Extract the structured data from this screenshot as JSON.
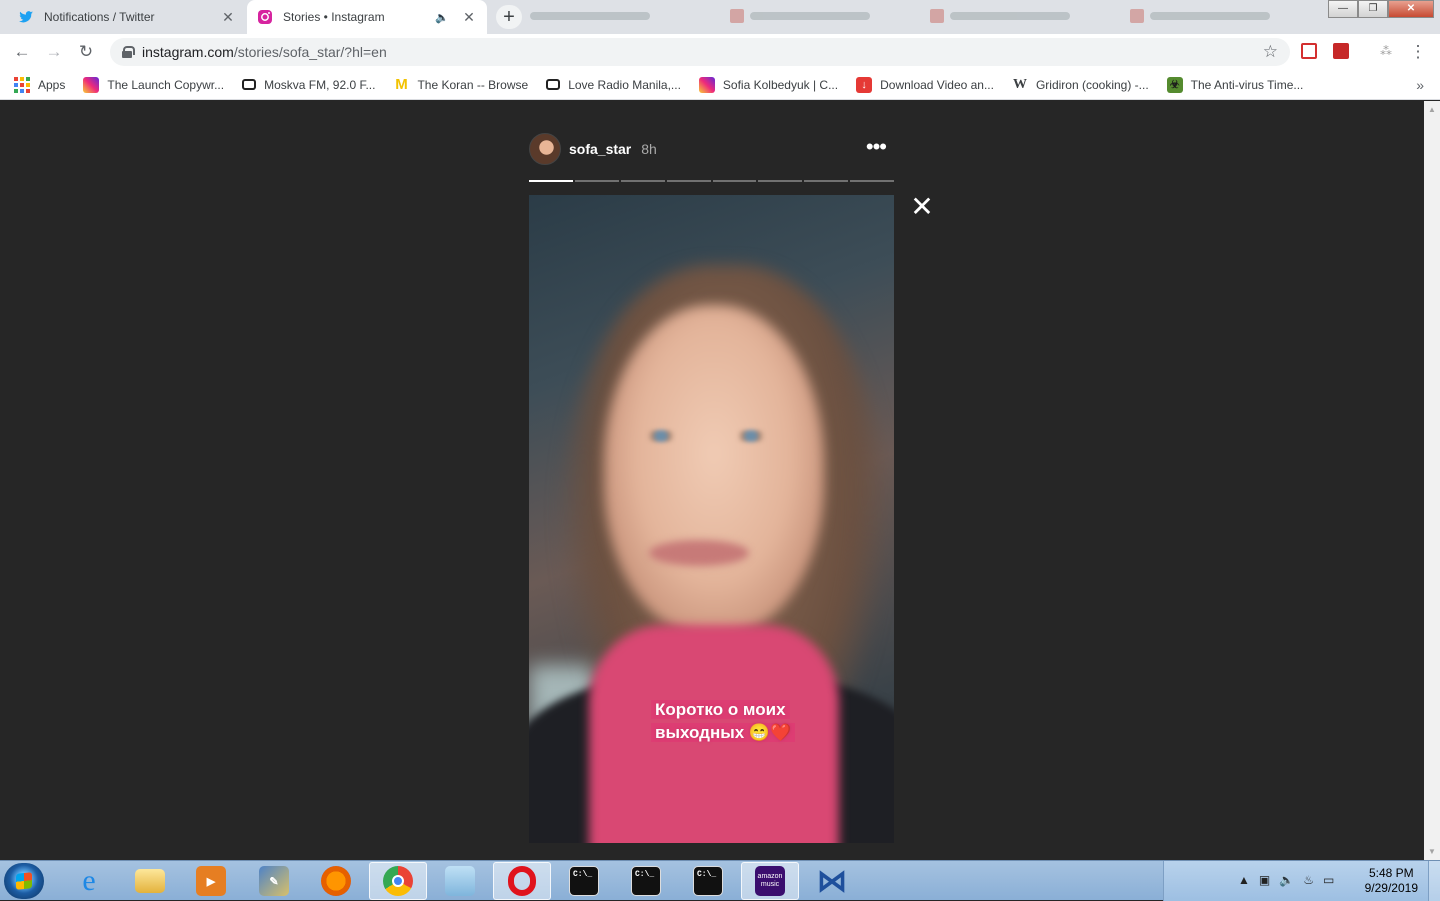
{
  "tabs": [
    {
      "title": "Notifications / Twitter",
      "icon": "twitter-icon",
      "active": false
    },
    {
      "title": "Stories • Instagram",
      "icon": "instagram-icon",
      "active": true
    }
  ],
  "address": {
    "host": "instagram.com",
    "path": "/stories/sofa_star/?hl=en"
  },
  "bookmarks": [
    {
      "label": "Apps",
      "icon": "apps-grid-icon"
    },
    {
      "label": "The Launch Copywr...",
      "icon": "instagram-icon"
    },
    {
      "label": "Moskva FM, 92.0 F...",
      "icon": "radio-icon"
    },
    {
      "label": "The Koran -- Browse",
      "icon": "michigan-m-icon"
    },
    {
      "label": "Love Radio Manila,...",
      "icon": "radio-icon"
    },
    {
      "label": "Sofia Kolbedyuk | C...",
      "icon": "instagram-icon"
    },
    {
      "label": "Download Video an...",
      "icon": "download-icon"
    },
    {
      "label": "Gridiron (cooking) -...",
      "icon": "wikipedia-icon"
    },
    {
      "label": "The Anti-virus Time...",
      "icon": "antivirus-icon"
    }
  ],
  "story": {
    "username": "sofa_star",
    "time": "8h",
    "segments_total": 8,
    "segment_current": 1,
    "caption_line1": "Коротко о моих",
    "caption_line2": "выходных 😁❤️"
  },
  "taskbar": {
    "apps": [
      "ie",
      "file-explorer",
      "media-player",
      "paint",
      "firefox",
      "chrome",
      "notepad",
      "opera",
      "cmd",
      "cmd",
      "cmd",
      "amazon-music",
      "visual-studio"
    ],
    "amazon_label": "amazon music",
    "cmd_label": "C:\\_"
  },
  "clock": {
    "time": "5:48 PM",
    "date": "9/29/2019"
  },
  "colors": {
    "story_bg": "#262626",
    "caption_bg": "#dd3d73",
    "twitter": "#1da1f2"
  }
}
